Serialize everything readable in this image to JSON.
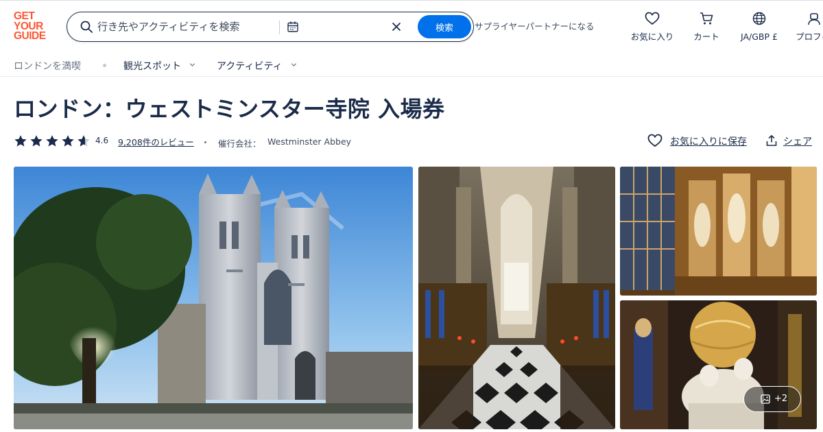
{
  "brand": {
    "logo_lines": [
      "GET",
      "YOUR",
      "GUIDE"
    ],
    "accent_color": "#ff5533",
    "primary_button_color": "#0071eb",
    "text_color": "#1a2b49"
  },
  "search": {
    "placeholder": "行き先やアクティビティを検索",
    "value": "",
    "date_icon": "calendar-icon",
    "clear_icon": "close-icon",
    "button_label": "検索"
  },
  "header": {
    "supplier_link": "サプライヤーパートナーになる",
    "actions": [
      {
        "icon": "heart-icon",
        "label": "お気に入り"
      },
      {
        "icon": "cart-icon",
        "label": "カート"
      },
      {
        "icon": "globe-icon",
        "label": "JA/GBP £"
      },
      {
        "icon": "profile-icon",
        "label": "プロフィ"
      }
    ]
  },
  "subnav": {
    "home": "ロンドンを満喫",
    "menus": [
      {
        "label": "観光スポット",
        "icon": "chevron-down-icon"
      },
      {
        "label": "アクティビティ",
        "icon": "chevron-down-icon"
      }
    ]
  },
  "product": {
    "title": "ロンドン：ウェストミンスター寺院 入場券",
    "rating": "4.6",
    "rating_value": 4.6,
    "rating_max": 5,
    "reviews": "9,208件のレビュー",
    "operator_label": "催行会社：",
    "operator_name": "Westminster Abbey",
    "save_label": "お気に入りに保存",
    "share_label": "シェア"
  },
  "gallery": {
    "more_count": "+2",
    "photos": [
      "abbey-exterior-photo",
      "abbey-nave-photo",
      "abbey-statues-photo",
      "abbey-monument-photo"
    ]
  }
}
